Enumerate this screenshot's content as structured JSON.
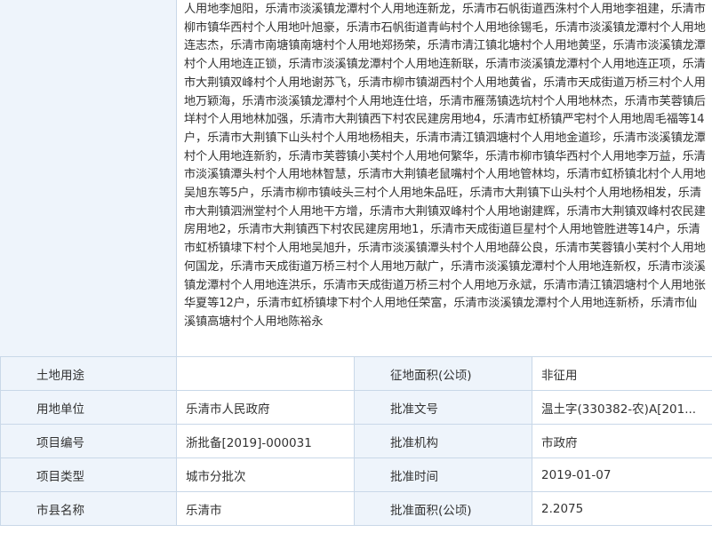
{
  "description": "人用地李旭阳，乐清市淡溪镇龙潭村个人用地连新龙，乐清市石帆街道西洙村个人用地李祖建，乐清市柳市镇华西村个人用地叶旭豪，乐清市石帆街道青屿村个人用地徐锡毛，乐清市淡溪镇龙潭村个人用地连志杰，乐清市南塘镇南塘村个人用地郑扬荣，乐清市清江镇北塘村个人用地黄坚，乐清市淡溪镇龙潭村个人用地连正锁，乐清市淡溪镇龙潭村个人用地连新联，乐清市淡溪镇龙潭村个人用地连正项，乐清市大荆镇双峰村个人用地谢苏飞，乐清市柳市镇湖西村个人用地黄省，乐清市天成街道万桥三村个人用地万颖海，乐清市淡溪镇龙潭村个人用地连仕培，乐清市雁荡镇选坑村个人用地林杰，乐清市芙蓉镇后垟村个人用地林加强，乐清市大荆镇西下村农民建房用地4，乐清市虹桥镇严宅村个人用地周毛福等14户，乐清市大荆镇下山头村个人用地杨相夫，乐清市清江镇泗塘村个人用地金道珍，乐清市淡溪镇龙潭村个人用地连新豹，乐清市芙蓉镇小芙村个人用地何繁华，乐清市柳市镇华西村个人用地李万益，乐清市淡溪镇潭头村个人用地林智慧，乐清市大荆镇老鼠嘴村个人用地管林均，乐清市虹桥镇北村个人用地吴旭东等5户，乐清市柳市镇岐头三村个人用地朱品旺，乐清市大荆镇下山头村个人用地杨相发，乐清市大荆镇泗洲堂村个人用地干方增，乐清市大荆镇双峰村个人用地谢建辉，乐清市大荆镇双峰村农民建房用地2，乐清市大荆镇西下村农民建房用地1，乐清市天成街道巨星村个人用地管胜进等14户，乐清市虹桥镇埭下村个人用地吴旭升，乐清市淡溪镇潭头村个人用地薛公良，乐清市芙蓉镇小芙村个人用地何国龙，乐清市天成街道万桥三村个人用地万献广，乐清市淡溪镇龙潭村个人用地连新权，乐清市淡溪镇龙潭村个人用地连洪乐，乐清市天成街道万桥三村个人用地万永斌，乐清市清江镇泗塘村个人用地张华夏等12户，乐清市虹桥镇埭下村个人用地任荣富，乐清市淡溪镇龙潭村个人用地连新桥，乐清市仙溪镇高塘村个人用地陈裕永",
  "rows": [
    {
      "label1": "土地用途",
      "value1": "",
      "label2": "征地面积(公顷)",
      "value2": "非征用"
    },
    {
      "label1": "用地单位",
      "value1": "乐清市人民政府",
      "label2": "批准文号",
      "value2": "温土字(330382-农)A[201..."
    },
    {
      "label1": "项目编号",
      "value1": "浙批备[2019]-000031",
      "label2": "批准机构",
      "value2": "市政府"
    },
    {
      "label1": "项目类型",
      "value1": "城市分批次",
      "label2": "批准时间",
      "value2": "2019-01-07"
    },
    {
      "label1": "市县名称",
      "value1": "乐清市",
      "label2": "批准面积(公顷)",
      "value2": "2.2075"
    }
  ]
}
